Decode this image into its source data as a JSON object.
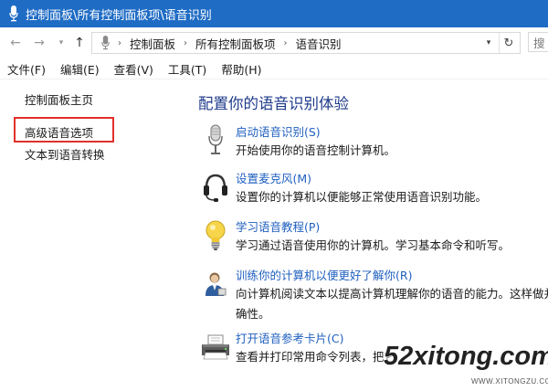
{
  "window": {
    "title": "控制面板\\所有控制面板项\\语音识别"
  },
  "navigation": {
    "back_icon": "back-arrow-icon",
    "forward_icon": "forward-arrow-icon",
    "up_icon": "up-arrow-icon",
    "breadcrumb": [
      "控制面板",
      "所有控制面板项",
      "语音识别"
    ],
    "search_placeholder": "搜"
  },
  "menu": {
    "items": [
      "文件(F)",
      "编辑(E)",
      "查看(V)",
      "工具(T)",
      "帮助(H)"
    ]
  },
  "sidebar": {
    "items": [
      {
        "label": "控制面板主页"
      },
      {
        "label": "高级语音选项",
        "highlighted": true
      },
      {
        "label": "文本到语音转换"
      }
    ]
  },
  "main": {
    "heading": "配置你的语音识别体验",
    "tasks": [
      {
        "icon": "microphone-icon",
        "link": "启动语音识别(S)",
        "desc": "开始使用你的语音控制计算机。"
      },
      {
        "icon": "headset-icon",
        "link": "设置麦克风(M)",
        "desc": "设置你的计算机以便能够正常使用语音识别功能。"
      },
      {
        "icon": "lightbulb-icon",
        "link": "学习语音教程(P)",
        "desc": "学习通过语音使用你的计算机。学习基本命令和听写。"
      },
      {
        "icon": "user-training-icon",
        "link": "训练你的计算机以便更好了解你(R)",
        "desc": "向计算机阅读文本以提高计算机理解你的语音的能力。这样做并不",
        "desc2": "确性。"
      },
      {
        "icon": "printer-icon",
        "link": "打开语音参考卡片(C)",
        "desc": "查看并打印常用命令列表，把它"
      }
    ]
  },
  "watermark": {
    "main": "52xitong.com",
    "sub": "WWW.XITONGZU.COM"
  },
  "colors": {
    "titlebar": "#1f6cc5",
    "heading": "#1d3a8a",
    "link": "#1f5fbf",
    "highlight": "#e0302b"
  }
}
